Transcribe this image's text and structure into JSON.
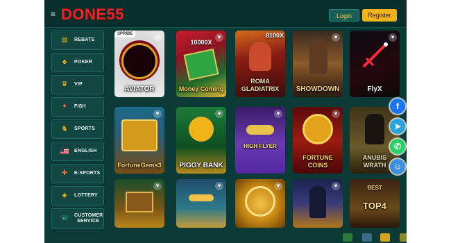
{
  "header": {
    "logo": "DONE55",
    "login_label": "Login",
    "register_label": "Register"
  },
  "sidebar": {
    "items": [
      {
        "label": "REBATE",
        "icon": "rebate-icon"
      },
      {
        "label": "POKER",
        "icon": "poker-icon"
      },
      {
        "label": "VIP",
        "icon": "vip-icon"
      },
      {
        "label": "FISH",
        "icon": "fish-icon"
      },
      {
        "label": "SPORTS",
        "icon": "sports-icon"
      },
      {
        "label": "ENGLISH",
        "icon": "flag-icon"
      },
      {
        "label": "E-SPORTS",
        "icon": "gamepad-icon"
      },
      {
        "label": "LOTTERY",
        "icon": "lottery-icon"
      },
      {
        "label": "CUSTOMER SERVICE",
        "icon": "support-icon"
      }
    ]
  },
  "games": {
    "row1": [
      {
        "title": "AVIATOR",
        "badge": "SPRIBE",
        "top": ""
      },
      {
        "title": "Money Coming",
        "badge": "",
        "top": "10000X"
      },
      {
        "title": "ROMA GLADIATRIX",
        "badge": "",
        "top": "8100X"
      },
      {
        "title": "SHOWDOWN",
        "badge": "",
        "top": ""
      },
      {
        "title": "FlyX",
        "badge": "",
        "top": ""
      }
    ],
    "row2": [
      {
        "title": "FortuneGems3",
        "badge": "",
        "top": ""
      },
      {
        "title": "PIGGY BANK",
        "badge": "",
        "top": ""
      },
      {
        "title": "HIGH FLYER",
        "badge": "",
        "top": ""
      },
      {
        "title": "FORTUNE COINS",
        "badge": "",
        "top": ""
      },
      {
        "title": "ANUBIS WRATH",
        "badge": "",
        "top": ""
      }
    ],
    "row3": [
      {
        "title": "",
        "badge": "",
        "top": ""
      },
      {
        "title": "",
        "badge": "",
        "top": ""
      },
      {
        "title": "",
        "badge": "",
        "top": ""
      },
      {
        "title": "",
        "badge": "",
        "top": ""
      },
      {
        "title": "TOP4",
        "badge": "",
        "top": "BEST"
      }
    ]
  },
  "social": [
    {
      "name": "facebook",
      "color": "#1877f2",
      "glyph": "f"
    },
    {
      "name": "telegram",
      "color": "#2aa3e3",
      "glyph": "➤"
    },
    {
      "name": "whatsapp",
      "color": "#25d366",
      "glyph": "✆"
    },
    {
      "name": "support",
      "color": "#3b8ee0",
      "glyph": "☺"
    }
  ]
}
